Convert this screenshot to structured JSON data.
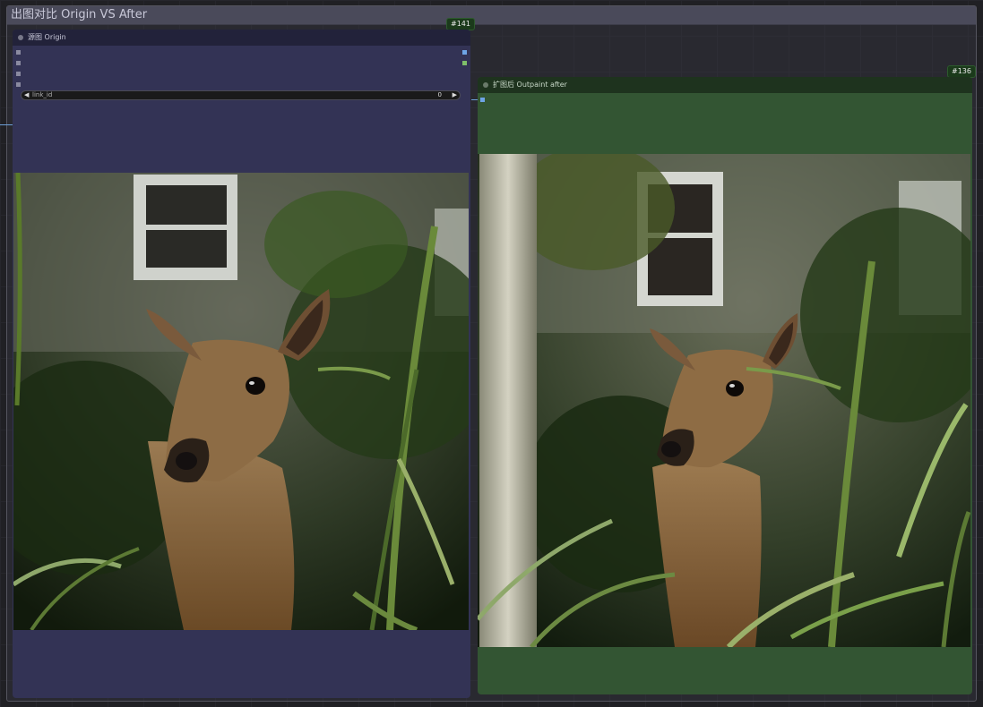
{
  "group": {
    "title": "出图对比 Origin VS After"
  },
  "nodes": {
    "origin": {
      "id_badge": "#141",
      "title": "源图 Origin",
      "widget": {
        "label": "link_id",
        "value": "0",
        "left_arrow": "◀",
        "right_arrow": "▶"
      },
      "image_alt": "Deer standing among tall grass in front of a building window"
    },
    "after": {
      "id_badge": "#136",
      "title": "扩图后 Outpaint after",
      "image_alt": "Outpainted wider view of the deer with a tree trunk on the left"
    }
  },
  "colors": {
    "origin_node": "#333355",
    "after_node": "#335533",
    "link": "#6d9fd8"
  }
}
